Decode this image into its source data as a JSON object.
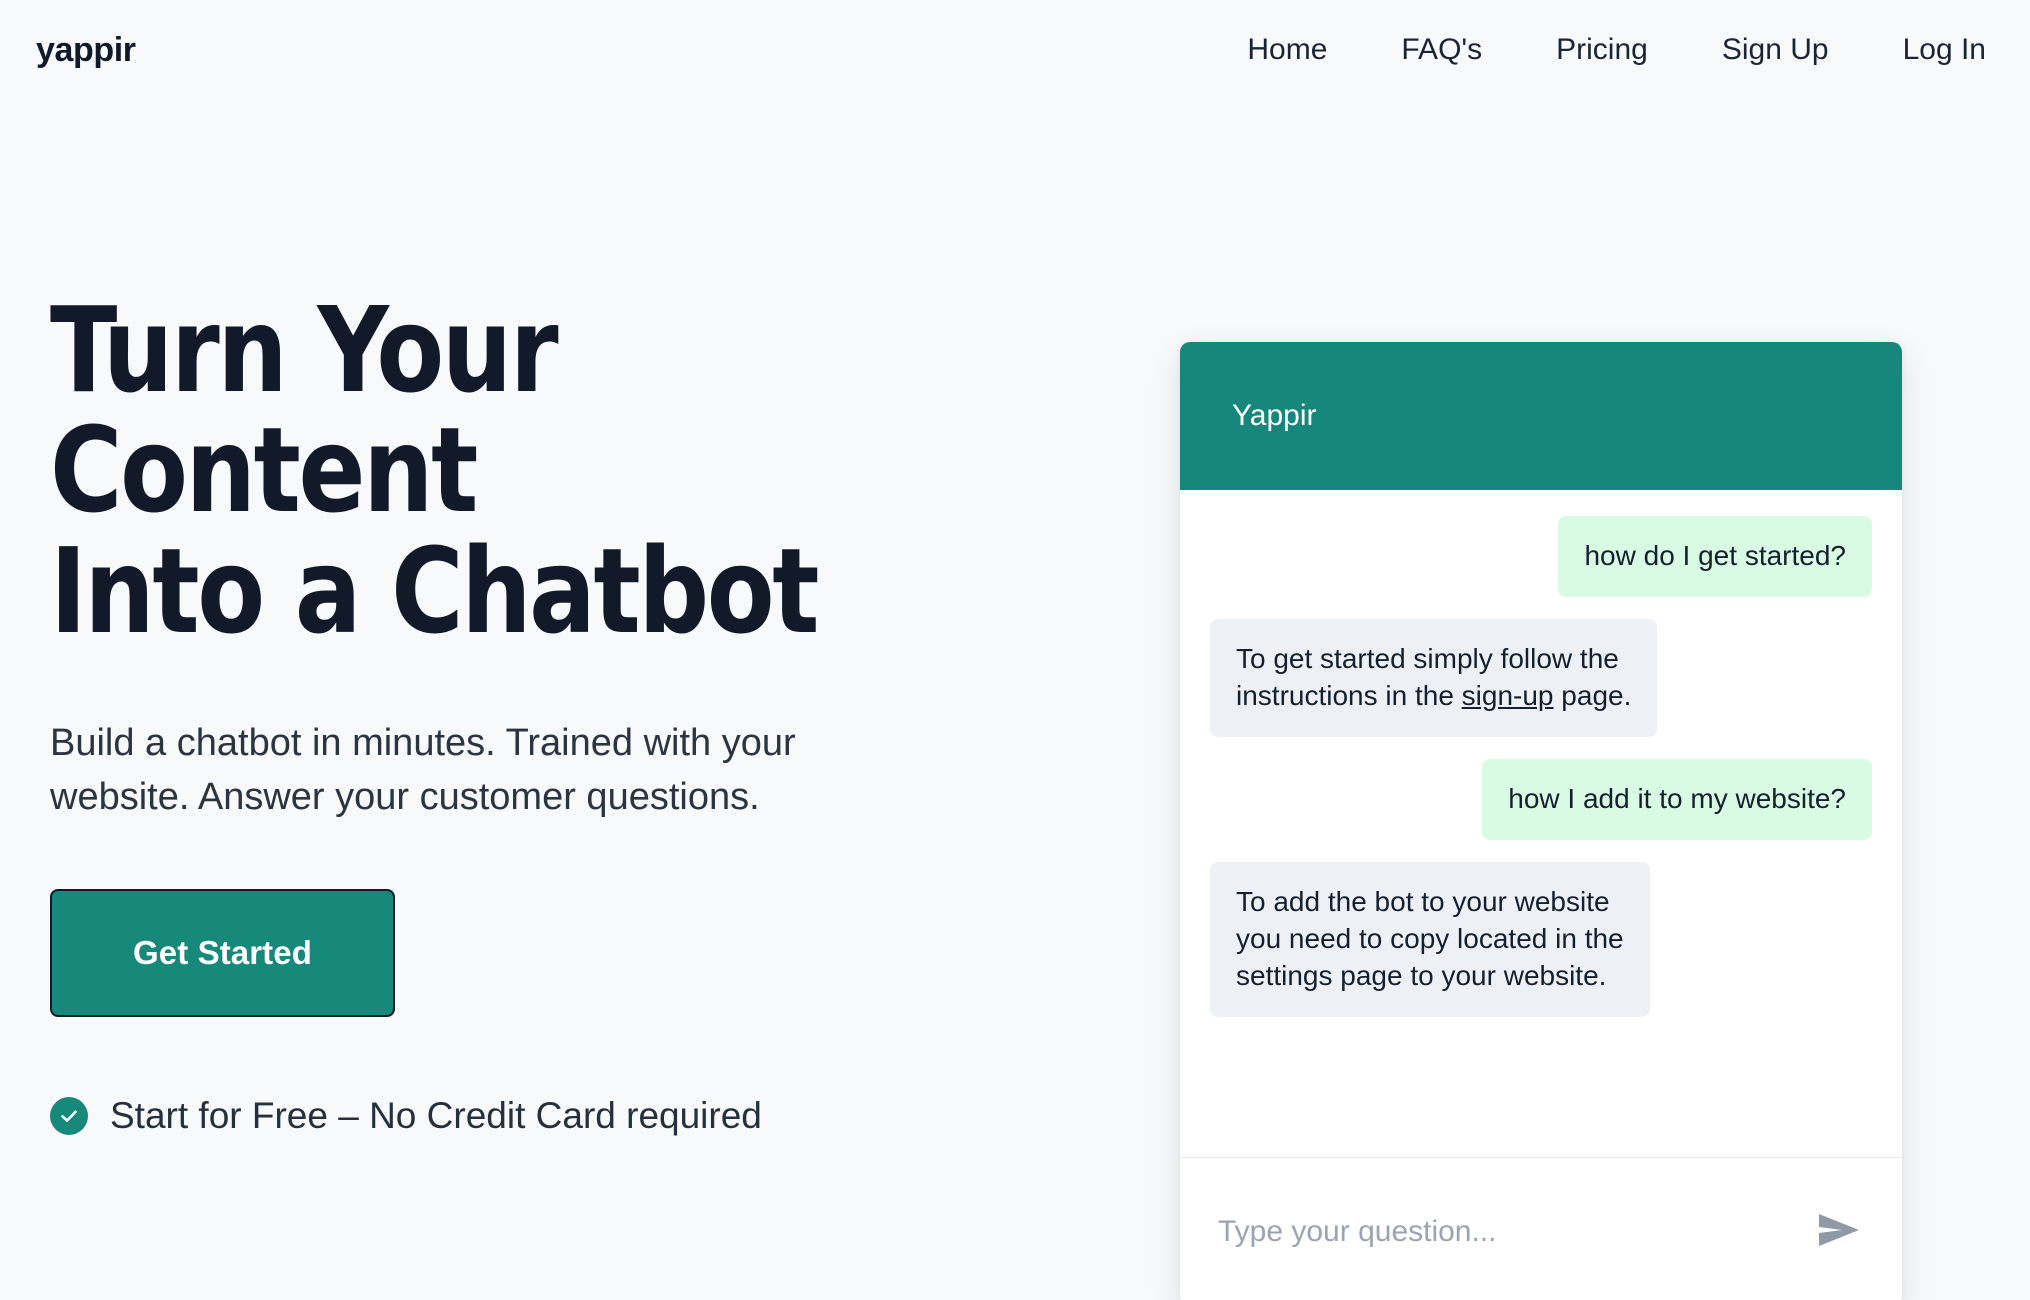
{
  "brand": {
    "name": "yappir"
  },
  "nav": {
    "items": [
      {
        "label": "Home",
        "name": "nav-link-home"
      },
      {
        "label": "FAQ's",
        "name": "nav-link-faqs"
      },
      {
        "label": "Pricing",
        "name": "nav-link-pricing"
      },
      {
        "label": "Sign Up",
        "name": "nav-link-sign-up"
      },
      {
        "label": "Log In",
        "name": "nav-link-log-in"
      }
    ]
  },
  "hero": {
    "title_lines": [
      "Turn Your",
      "Content",
      "Into a Chatbot"
    ],
    "subtitle_lines": [
      "Build a chatbot in minutes. Trained with your",
      "website. Answer your customer questions."
    ],
    "cta_label": "Get Started",
    "assurance_text": "Start for Free – No Credit Card required",
    "check_icon": "check-circle-icon"
  },
  "chat": {
    "header_title": "Yappir",
    "messages": [
      {
        "sender": "user",
        "lines": [
          "how do I get started?"
        ]
      },
      {
        "sender": "bot",
        "lines": [
          "To get started simply follow the"
        ],
        "tail_before": "instructions in the ",
        "tail_link": "sign-up",
        "tail_after": " page."
      },
      {
        "sender": "user",
        "lines": [
          "how I add it to my website?"
        ]
      },
      {
        "sender": "bot",
        "lines": [
          "To add the bot to your website",
          "you need to copy located in the",
          "settings page to your website."
        ]
      }
    ],
    "input_placeholder": "Type your question...",
    "input_value": "",
    "send_icon": "send-paper-plane-icon"
  },
  "colors": {
    "page_background": "#f7f9fa",
    "teal_accent": "#17897b",
    "chat_header_teal": "#17877b",
    "user_bubble": "#d9fbe4",
    "bot_bubble": "#edf1f6",
    "text_dark": "#121a29",
    "placeholder_gray": "#9aa3b0"
  }
}
